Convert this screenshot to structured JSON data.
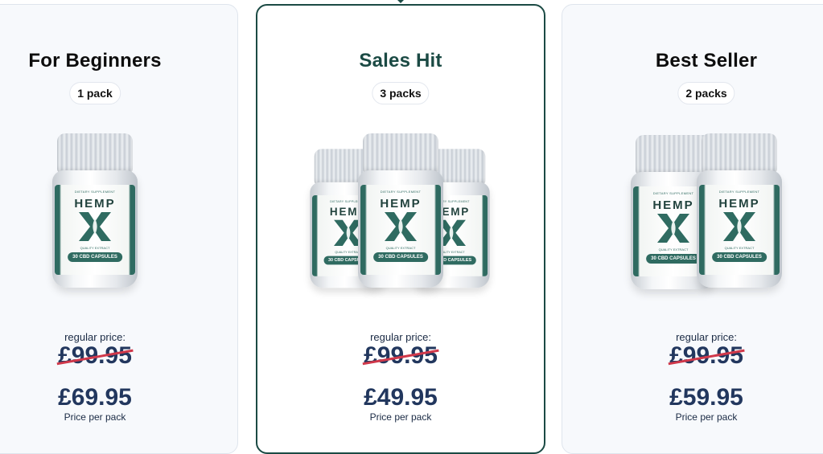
{
  "plans": [
    {
      "title": "For Beginners",
      "pack_label": "1 pack",
      "regular_label": "regular price:",
      "old_price": "£99.95",
      "new_price": "£69.95",
      "per_label": "Price per pack"
    },
    {
      "title": "Sales Hit",
      "pack_label": "3 packs",
      "regular_label": "regular price:",
      "old_price": "£99.95",
      "new_price": "£49.95",
      "per_label": "Price per pack"
    },
    {
      "title": "Best Seller",
      "pack_label": "2 packs",
      "regular_label": "regular price:",
      "old_price": "£99.95",
      "new_price": "£59.95",
      "per_label": "Price per pack"
    }
  ],
  "bottle_label": {
    "supplement": "DIETARY SUPPLEMENT",
    "brand": "HEMP",
    "extract": "QUALITY EXTRACT",
    "capsules": "30 CBD CAPSULES"
  },
  "colors": {
    "brand_green": "#1b4a44",
    "price_navy": "#22375e",
    "strike_red": "#d0384a"
  }
}
